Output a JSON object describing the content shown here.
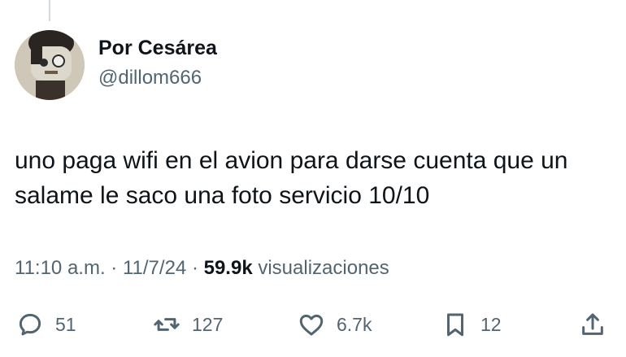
{
  "author": {
    "display_name": "Por Cesárea",
    "handle": "@dillom666"
  },
  "tweet": {
    "text": "uno paga wifi en el avion para darse cuenta que un salame le saco una foto servicio 10/10"
  },
  "meta": {
    "time": "11:10 a.m.",
    "separator": "·",
    "date": "11/7/24",
    "views_count": "59.9k",
    "views_label": "visualizaciones"
  },
  "actions": {
    "replies": "51",
    "reposts": "127",
    "likes": "6.7k",
    "bookmarks": "12"
  },
  "colors": {
    "text": "#0f1419",
    "secondary": "#536471",
    "thread_line": "#cfd9de"
  }
}
